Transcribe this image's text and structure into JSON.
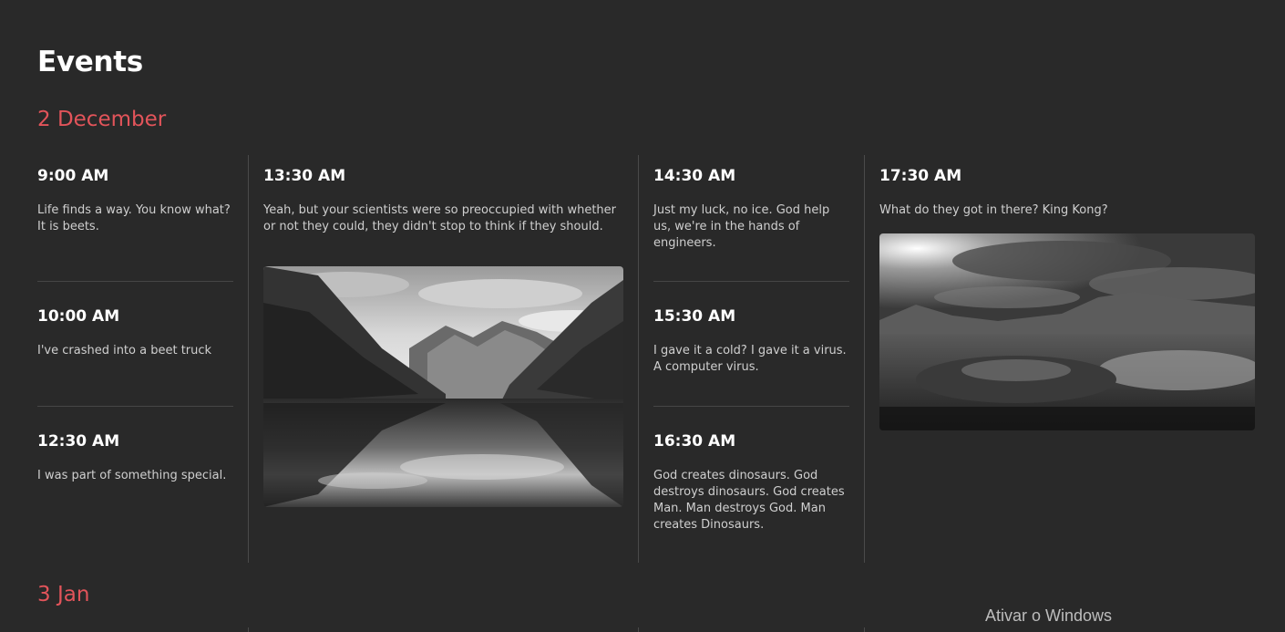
{
  "page": {
    "title": "Events",
    "watermark": "Ativar o Windows"
  },
  "sections": [
    {
      "date": "2 December",
      "columns": [
        {
          "events": [
            {
              "time": "9:00 AM",
              "description": "Life finds a way. You know what? It is beets."
            },
            {
              "time": "10:00 AM",
              "description": "I've crashed into a beet truck"
            },
            {
              "time": "12:30 AM",
              "description": "I was part of something special."
            }
          ]
        },
        {
          "events": [
            {
              "time": "13:30 AM",
              "description": "Yeah, but your scientists were so preoccupied with whether or not they could, they didn't stop to think if they should.",
              "image": "mountain-lake-reflection-photo"
            }
          ]
        },
        {
          "events": [
            {
              "time": "14:30 AM",
              "description": "Just my luck, no ice. God help us, we're in the hands of engineers."
            },
            {
              "time": "15:30 AM",
              "description": "I gave it a cold? I gave it a virus. A computer virus."
            },
            {
              "time": "16:30 AM",
              "description": "God creates dinosaurs. God destroys dinosaurs. God creates Man. Man destroys God. Man creates Dinosaurs."
            }
          ]
        },
        {
          "events": [
            {
              "time": "17:30 AM",
              "description": "What do they got in there? King Kong?",
              "image": "stormy-highlands-photo"
            }
          ]
        }
      ]
    },
    {
      "date": "3 Jan"
    }
  ],
  "colors": {
    "background": "#292929",
    "accent": "#e2545a",
    "text": "#ffffff",
    "muted": "#cfcfcf"
  }
}
